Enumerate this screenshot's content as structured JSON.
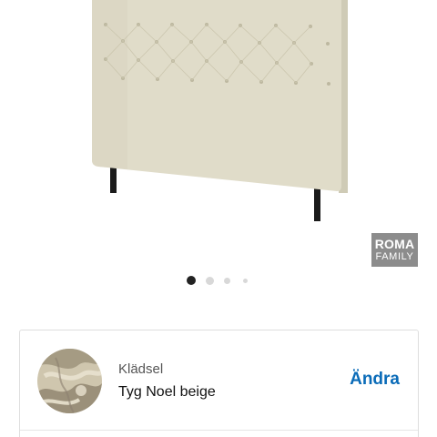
{
  "product": {
    "image_icon": "headboard-product-image",
    "brand_logo": {
      "line1": "ROMA",
      "line2": "FAMILY",
      "color": "#8c8c8c"
    }
  },
  "carousel": {
    "total": 4,
    "active": 1,
    "active_color": "#222222",
    "inactive_color": "#d8d8d8"
  },
  "upholstery": {
    "label": "Klädsel",
    "value": "Tyg Noel beige",
    "action_label": "Ändra",
    "action_color": "#0a6bb8",
    "swatch_icon": "fabric-swatch-image"
  }
}
